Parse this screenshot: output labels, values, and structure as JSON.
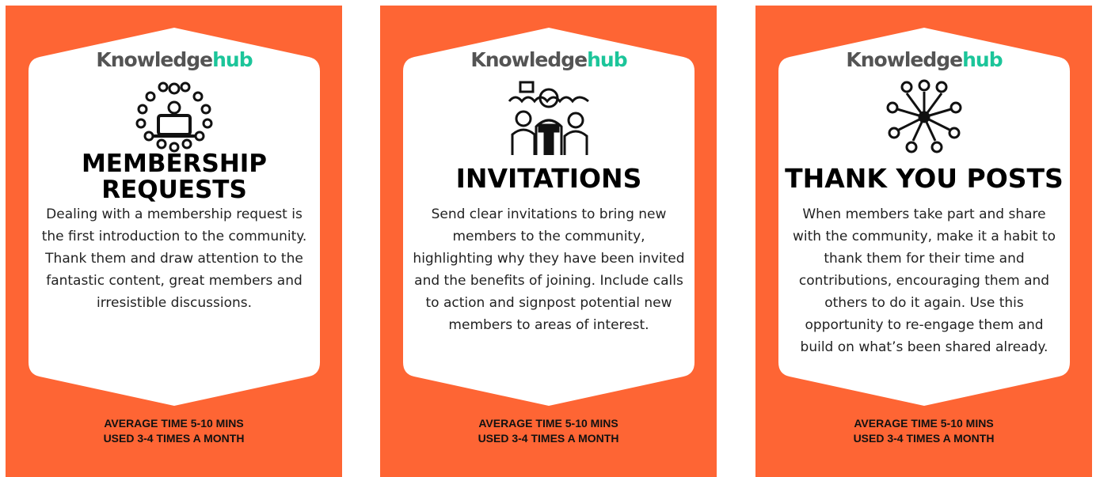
{
  "brand": {
    "logo_part1": "Knowledge",
    "logo_part2": "hub",
    "text_color": "#545454",
    "accent_color": "#1cc59a"
  },
  "theme": {
    "card_color": "#fe6534",
    "panel_color": "#ffffff"
  },
  "cards": [
    {
      "title_line1": "MEMBERSHIP",
      "title_line2": "REQUESTS",
      "illustration": "group-around-laptop-icon",
      "description": "Dealing with a membership request is the first introduction to the community. Thank them and draw attention to the fantastic content, great members and irresistible discussions.",
      "footer_line1": "AVERAGE TIME 5-10 MINS",
      "footer_line2": "USED 3-4 TIMES A MONTH"
    },
    {
      "title_line1": "INVITATIONS",
      "illustration": "people-at-podium-icon",
      "description": "Send clear invitations to bring new members to the community, highlighting why they have been invited and the benefits of joining. Include calls to action and signpost potential new members to areas of interest.",
      "footer_line1": "AVERAGE TIME 5-10 MINS",
      "footer_line2": "USED 3-4 TIMES A MONTH"
    },
    {
      "title_line1": "THANK YOU POSTS",
      "illustration": "group-hands-together-icon",
      "description": "When members take part and share with the community, make it a habit to thank them for their time and contributions, encouraging them and others to do it again. Use this opportunity to re-engage them and build on what’s been shared already.",
      "footer_line1": "AVERAGE TIME 5-10 MINS",
      "footer_line2": "USED 3-4 TIMES A MONTH"
    }
  ]
}
